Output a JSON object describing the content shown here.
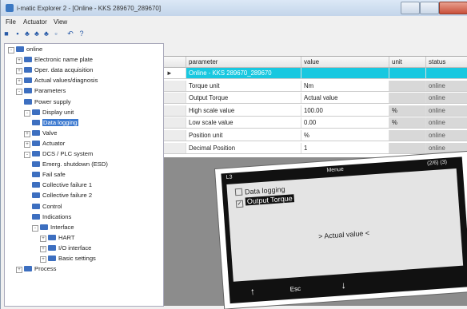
{
  "window": {
    "title": "i-matic Explorer 2 - [Online - KKS 289670_289670]"
  },
  "menu": [
    "File",
    "Actuator",
    "View"
  ],
  "tree": [
    {
      "label": "online",
      "depth": 0,
      "exp": "-"
    },
    {
      "label": "Electronic name plate",
      "depth": 1,
      "exp": "+"
    },
    {
      "label": "Oper. data acquisition",
      "depth": 1,
      "exp": "+"
    },
    {
      "label": "Actual values/diagnosis",
      "depth": 1,
      "exp": "+"
    },
    {
      "label": "Parameters",
      "depth": 1,
      "exp": "-"
    },
    {
      "label": "Power supply",
      "depth": 2,
      "exp": ""
    },
    {
      "label": "Display unit",
      "depth": 2,
      "exp": "-"
    },
    {
      "label": "Data logging",
      "depth": 3,
      "exp": "",
      "selected": true
    },
    {
      "label": "Valve",
      "depth": 2,
      "exp": "+"
    },
    {
      "label": "Actuator",
      "depth": 2,
      "exp": "+"
    },
    {
      "label": "DCS / PLC system",
      "depth": 2,
      "exp": "-"
    },
    {
      "label": "Emerg. shutdown (ESD)",
      "depth": 3,
      "exp": ""
    },
    {
      "label": "Fail safe",
      "depth": 3,
      "exp": ""
    },
    {
      "label": "Collective failure 1",
      "depth": 3,
      "exp": ""
    },
    {
      "label": "Collective failure 2",
      "depth": 3,
      "exp": ""
    },
    {
      "label": "Control",
      "depth": 3,
      "exp": ""
    },
    {
      "label": "Indications",
      "depth": 3,
      "exp": ""
    },
    {
      "label": "Interface",
      "depth": 3,
      "exp": "-"
    },
    {
      "label": "HART",
      "depth": 4,
      "exp": "+"
    },
    {
      "label": "I/O interface",
      "depth": 4,
      "exp": "+"
    },
    {
      "label": "Basic settings",
      "depth": 4,
      "exp": "+"
    },
    {
      "label": "Process",
      "depth": 1,
      "exp": "+"
    }
  ],
  "grid": {
    "headers": [
      "parameter",
      "value",
      "unit",
      "status"
    ],
    "rows": [
      {
        "parameter": "Online - KKS 289670_289670",
        "value": "",
        "unit": "",
        "status": "",
        "online": true
      },
      {
        "parameter": "Torque unit",
        "value": "Nm",
        "unit": "",
        "status": "online"
      },
      {
        "parameter": "Output Torque",
        "value": "Actual value",
        "unit": "",
        "status": "online"
      },
      {
        "parameter": "High scale value",
        "value": "100.00",
        "unit": "%",
        "status": "online"
      },
      {
        "parameter": "Low scale value",
        "value": "0.00",
        "unit": "%",
        "status": "online"
      },
      {
        "parameter": "Position unit",
        "value": "%",
        "unit": "",
        "status": "online"
      },
      {
        "parameter": "Decimal Position",
        "value": "1",
        "unit": "",
        "status": "online"
      }
    ]
  },
  "display": {
    "corner": "L3",
    "title": "Menue",
    "page": "(2/6) (3)",
    "items": [
      {
        "label": "Data logging",
        "checked": false,
        "highlight": false
      },
      {
        "label": "Output Torque",
        "checked": true,
        "highlight": true
      }
    ],
    "value": "> Actual value <",
    "footer": [
      "↑",
      "Esc",
      "↓"
    ]
  }
}
